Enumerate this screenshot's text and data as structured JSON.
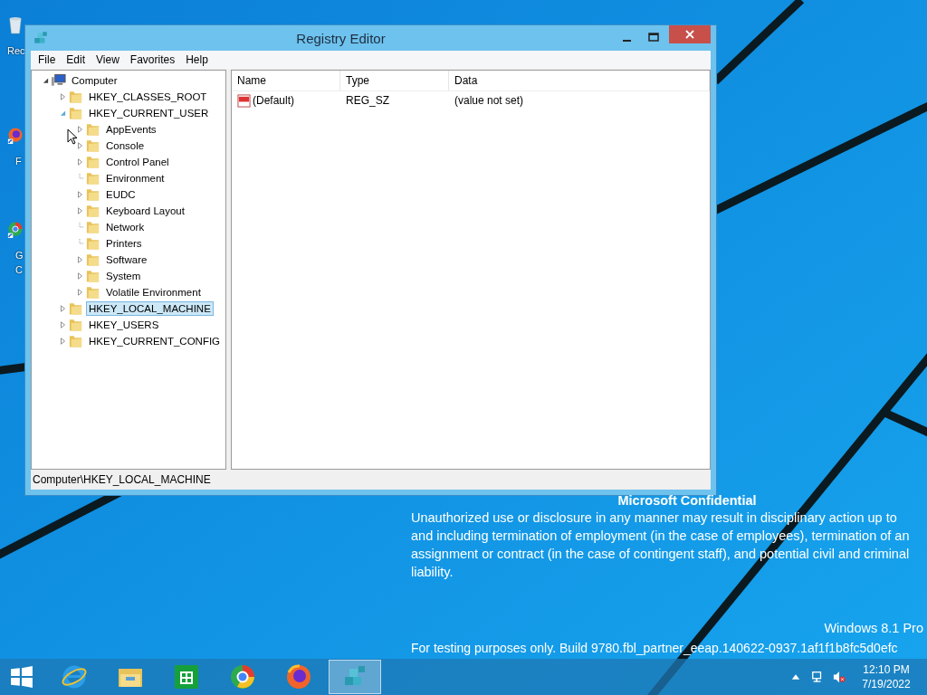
{
  "desktop_icons": [
    {
      "kind": "recycle",
      "lines": [
        "Rec"
      ]
    },
    {
      "kind": "firefox",
      "lines": [
        "F"
      ]
    },
    {
      "kind": "chrome",
      "lines": [
        "G",
        "C"
      ]
    }
  ],
  "window": {
    "title": "Registry Editor"
  },
  "menu": [
    "File",
    "Edit",
    "View",
    "Favorites",
    "Help"
  ],
  "tree": [
    {
      "label": "Computer",
      "kind": "computer",
      "has_children": true,
      "expanded": true,
      "selected": false,
      "children": [
        {
          "label": "HKEY_CLASSES_ROOT",
          "kind": "folder",
          "has_children": true,
          "expanded": false,
          "selected": false
        },
        {
          "label": "HKEY_CURRENT_USER",
          "kind": "folder",
          "has_children": true,
          "expanded": true,
          "selected": false,
          "children": [
            {
              "label": "AppEvents",
              "kind": "folder",
              "has_children": true,
              "expanded": false,
              "selected": false
            },
            {
              "label": "Console",
              "kind": "folder",
              "has_children": true,
              "expanded": false,
              "selected": false
            },
            {
              "label": "Control Panel",
              "kind": "folder",
              "has_children": true,
              "expanded": false,
              "selected": false
            },
            {
              "label": "Environment",
              "kind": "folder",
              "selected": false
            },
            {
              "label": "EUDC",
              "kind": "folder",
              "has_children": true,
              "expanded": false,
              "selected": false
            },
            {
              "label": "Keyboard Layout",
              "kind": "folder",
              "has_children": true,
              "expanded": false,
              "selected": false
            },
            {
              "label": "Network",
              "kind": "folder",
              "selected": false
            },
            {
              "label": "Printers",
              "kind": "folder",
              "selected": false
            },
            {
              "label": "Software",
              "kind": "folder",
              "has_children": true,
              "expanded": false,
              "selected": false
            },
            {
              "label": "System",
              "kind": "folder",
              "has_children": true,
              "expanded": false,
              "selected": false
            },
            {
              "label": "Volatile Environment",
              "kind": "folder",
              "has_children": true,
              "expanded": false,
              "selected": false
            }
          ]
        },
        {
          "label": "HKEY_LOCAL_MACHINE",
          "kind": "folder",
          "has_children": true,
          "expanded": false,
          "selected": true
        },
        {
          "label": "HKEY_USERS",
          "kind": "folder",
          "has_children": true,
          "expanded": false,
          "selected": false
        },
        {
          "label": "HKEY_CURRENT_CONFIG",
          "kind": "folder",
          "has_children": true,
          "expanded": false,
          "selected": false
        }
      ]
    }
  ],
  "table": {
    "columns": [
      "Name",
      "Type",
      "Data"
    ],
    "rows": [
      {
        "name": "(Default)",
        "type": "REG_SZ",
        "data": "(value not set)",
        "selected": false
      }
    ]
  },
  "status_bar": "Computer\\HKEY_LOCAL_MACHINE",
  "watermark": {
    "heading": "Microsoft Confidential",
    "body": "Unauthorized use or disclosure in any manner may result in disciplinary action up to and including termination of employment (in the case of employees), termination of an assignment or contract (in the case of contingent staff), and potential civil and criminal liability.",
    "edition": "Windows 8.1 Pro",
    "build": "For testing purposes only. Build 9780.fbl_partner_eeap.140622-0937.1af1f1b8fc5d0efc"
  },
  "taskbar": {
    "apps": [
      {
        "kind": "ie",
        "selected": false
      },
      {
        "kind": "explorer",
        "selected": false
      },
      {
        "kind": "store",
        "selected": false
      },
      {
        "kind": "chrome",
        "selected": false
      },
      {
        "kind": "firefox",
        "selected": false
      },
      {
        "kind": "regedit",
        "selected": true
      }
    ],
    "time": "12:10 PM",
    "date": "7/19/2022"
  }
}
